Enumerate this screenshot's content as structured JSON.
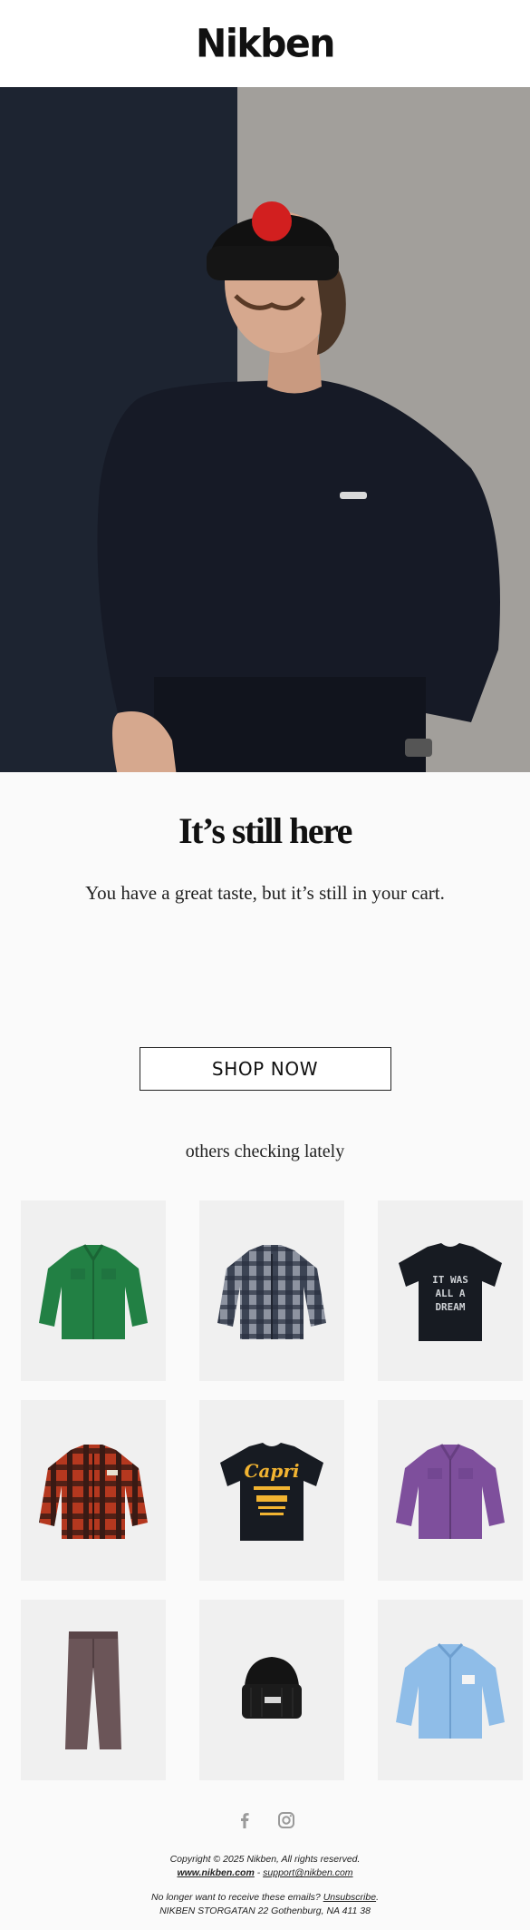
{
  "brand": {
    "logo_text": "Nikben"
  },
  "hero": {
    "alt": "Man wearing a black beanie with red pom-pom and navy sweatshirt"
  },
  "main": {
    "headline": "It’s still here",
    "subtext": "You have a great taste, but it’s still in your cart.",
    "cta_label": "SHOP NOW",
    "others_heading": "others checking lately"
  },
  "products": [
    {
      "name": "green overshirt",
      "icon": "green-jacket"
    },
    {
      "name": "grey check overshirt",
      "icon": "grey-plaid-jacket"
    },
    {
      "name": "it was all a dream tee",
      "icon": "black-graphic-tee"
    },
    {
      "name": "red check overshirt",
      "icon": "red-plaid-jacket"
    },
    {
      "name": "capri motel tee",
      "icon": "black-print-tee"
    },
    {
      "name": "purple overshirt",
      "icon": "purple-jacket"
    },
    {
      "name": "trousers",
      "icon": "brown-trousers"
    },
    {
      "name": "beanie",
      "icon": "black-beanie"
    },
    {
      "name": "light blue shirt",
      "icon": "blue-shirt"
    }
  ],
  "tee_print": {
    "line1": "IT WAS",
    "line2": "ALL A",
    "line3": "DREAM"
  },
  "capri_print": {
    "brand": "Capri"
  },
  "footer": {
    "copyright": "Copyright © 2025 Nikben, All rights reserved.",
    "website": "www.nikben.com",
    "separator": " - ",
    "email": "support@nikben.com",
    "unsubscribe_prefix": "No longer want to receive these emails? ",
    "unsubscribe_label": "Unsubscribe",
    "unsubscribe_suffix": ".",
    "address": "NIKBEN STORGATAN 22 Gothenburg, NA 411 38"
  },
  "colors": {
    "accent_red": "#d21f1f",
    "navy": "#1d2431",
    "tile_bg": "#f0f0f0"
  }
}
